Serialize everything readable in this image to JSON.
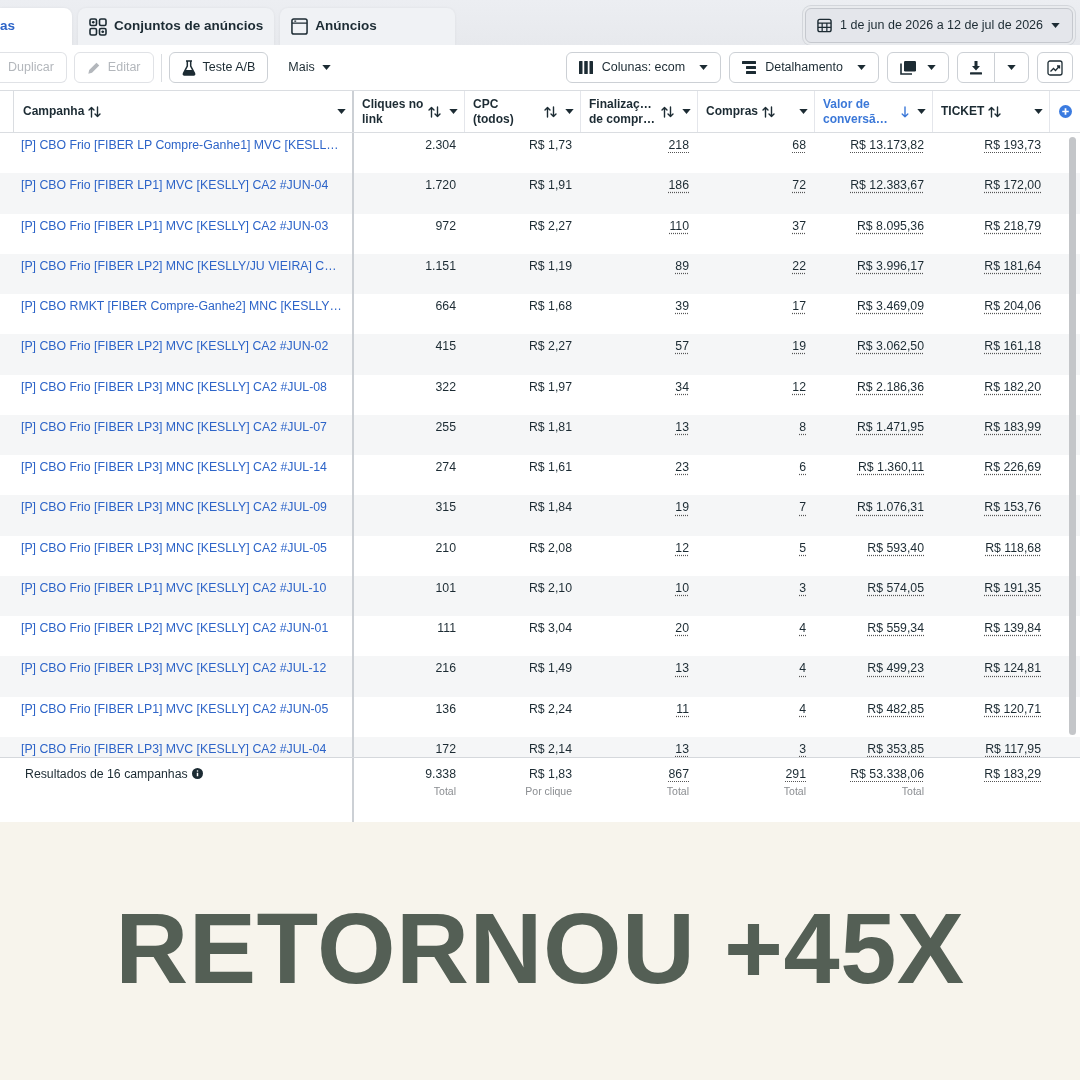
{
  "tabs": [
    {
      "label": "as",
      "selected": true
    },
    {
      "label": "Conjuntos de anúncios",
      "selected": false
    },
    {
      "label": "Anúncios",
      "selected": false
    }
  ],
  "date_range": {
    "label": "1 de jun de 2026 a 12 de jul de 2026"
  },
  "toolbar": {
    "actions": [
      {
        "label": "Duplicar",
        "kind": "button",
        "disabled": true
      },
      {
        "label": "Editar",
        "kind": "button",
        "disabled": true
      },
      {
        "label": "Teste A/B",
        "kind": "button",
        "disabled": false
      },
      {
        "label": "Mais",
        "kind": "menu",
        "disabled": false
      }
    ],
    "views": [
      {
        "label": "Colunas: ecom"
      },
      {
        "label": "Detalhamento"
      }
    ]
  },
  "table": {
    "columns": [
      {
        "label": "Campanha",
        "kind": "name",
        "sorted": false,
        "underlined": false
      },
      {
        "label": "Cliques no link",
        "kind": "number",
        "sorted": false,
        "underlined": false
      },
      {
        "label": "CPC (todos)",
        "kind": "number",
        "sorted": false,
        "underlined": false
      },
      {
        "label": "Finalizaç… de compr…",
        "kind": "number",
        "sorted": false,
        "underlined": true
      },
      {
        "label": "Compras",
        "kind": "number",
        "sorted": false,
        "underlined": true
      },
      {
        "label": "Valor de conversã…",
        "kind": "number",
        "sorted": true,
        "underlined": true
      },
      {
        "label": "TICKET",
        "kind": "number",
        "sorted": false,
        "underlined": true
      }
    ],
    "rows": [
      {
        "cells": [
          "[P] CBO Frio [FIBER LP Compre-Ganhe1] MVC [KESLL…",
          "2.304",
          "R$ 1,73",
          "218",
          "68",
          "R$ 13.173,82",
          "R$ 193,73"
        ]
      },
      {
        "cells": [
          "[P] CBO Frio [FIBER LP1] MVC [KESLLY] CA2 #JUN-04",
          "1.720",
          "R$ 1,91",
          "186",
          "72",
          "R$ 12.383,67",
          "R$ 172,00"
        ]
      },
      {
        "cells": [
          "[P] CBO Frio [FIBER LP1] MVC [KESLLY] CA2 #JUN-03",
          "972",
          "R$ 2,27",
          "110",
          "37",
          "R$ 8.095,36",
          "R$ 218,79"
        ]
      },
      {
        "cells": [
          "[P] CBO Frio [FIBER LP2] MNC [KESLLY/JU VIEIRA] C…",
          "1.151",
          "R$ 1,19",
          "89",
          "22",
          "R$ 3.996,17",
          "R$ 181,64"
        ]
      },
      {
        "cells": [
          "[P] CBO RMKT [FIBER Compre-Ganhe2] MNC [KESLLY…",
          "664",
          "R$ 1,68",
          "39",
          "17",
          "R$ 3.469,09",
          "R$ 204,06"
        ]
      },
      {
        "cells": [
          "[P] CBO Frio [FIBER LP2] MVC [KESLLY] CA2 #JUN-02",
          "415",
          "R$ 2,27",
          "57",
          "19",
          "R$ 3.062,50",
          "R$ 161,18"
        ]
      },
      {
        "cells": [
          "[P] CBO Frio [FIBER LP3] MNC [KESLLY] CA2 #JUL-08",
          "322",
          "R$ 1,97",
          "34",
          "12",
          "R$ 2.186,36",
          "R$ 182,20"
        ]
      },
      {
        "cells": [
          "[P] CBO Frio [FIBER LP3] MNC [KESLLY] CA2 #JUL-07",
          "255",
          "R$ 1,81",
          "13",
          "8",
          "R$ 1.471,95",
          "R$ 183,99"
        ]
      },
      {
        "cells": [
          "[P] CBO Frio [FIBER LP3] MNC [KESLLY] CA2 #JUL-14",
          "274",
          "R$ 1,61",
          "23",
          "6",
          "R$ 1.360,11",
          "R$ 226,69"
        ]
      },
      {
        "cells": [
          "[P] CBO Frio [FIBER LP3] MNC [KESLLY] CA2 #JUL-09",
          "315",
          "R$ 1,84",
          "19",
          "7",
          "R$ 1.076,31",
          "R$ 153,76"
        ]
      },
      {
        "cells": [
          "[P] CBO Frio [FIBER LP3] MNC [KESLLY] CA2 #JUL-05",
          "210",
          "R$ 2,08",
          "12",
          "5",
          "R$ 593,40",
          "R$ 118,68"
        ]
      },
      {
        "cells": [
          "[P] CBO Frio [FIBER LP1] MVC [KESLLY] CA2 #JUL-10",
          "101",
          "R$ 2,10",
          "10",
          "3",
          "R$ 574,05",
          "R$ 191,35"
        ]
      },
      {
        "cells": [
          "[P] CBO Frio [FIBER LP2] MVC [KESLLY] CA2 #JUN-01",
          "111",
          "R$ 3,04",
          "20",
          "4",
          "R$ 559,34",
          "R$ 139,84"
        ]
      },
      {
        "cells": [
          "[P] CBO Frio [FIBER LP3] MVC [KESLLY] CA2 #JUL-12",
          "216",
          "R$ 1,49",
          "13",
          "4",
          "R$ 499,23",
          "R$ 124,81"
        ]
      },
      {
        "cells": [
          "[P] CBO Frio [FIBER LP1] MVC [KESLLY] CA2 #JUN-05",
          "136",
          "R$ 2,24",
          "11",
          "4",
          "R$ 482,85",
          "R$ 120,71"
        ]
      },
      {
        "cells": [
          "[P] CBO Frio [FIBER LP3] MVC [KESLLY] CA2 #JUL-04",
          "172",
          "R$ 2,14",
          "13",
          "3",
          "R$ 353,85",
          "R$ 117,95"
        ]
      }
    ],
    "summary": {
      "label": "Resultados de 16 campanhas",
      "totals": [
        {
          "value": "9.338",
          "note": "Total"
        },
        {
          "value": "R$ 1,83",
          "note": "Por clique"
        },
        {
          "value": "867",
          "note": "Total"
        },
        {
          "value": "291",
          "note": "Total"
        },
        {
          "value": "R$ 53.338,06",
          "note": "Total"
        },
        {
          "value": "R$ 183,29"
        }
      ]
    }
  },
  "banner": {
    "headline": "RETORNOU +45X"
  }
}
